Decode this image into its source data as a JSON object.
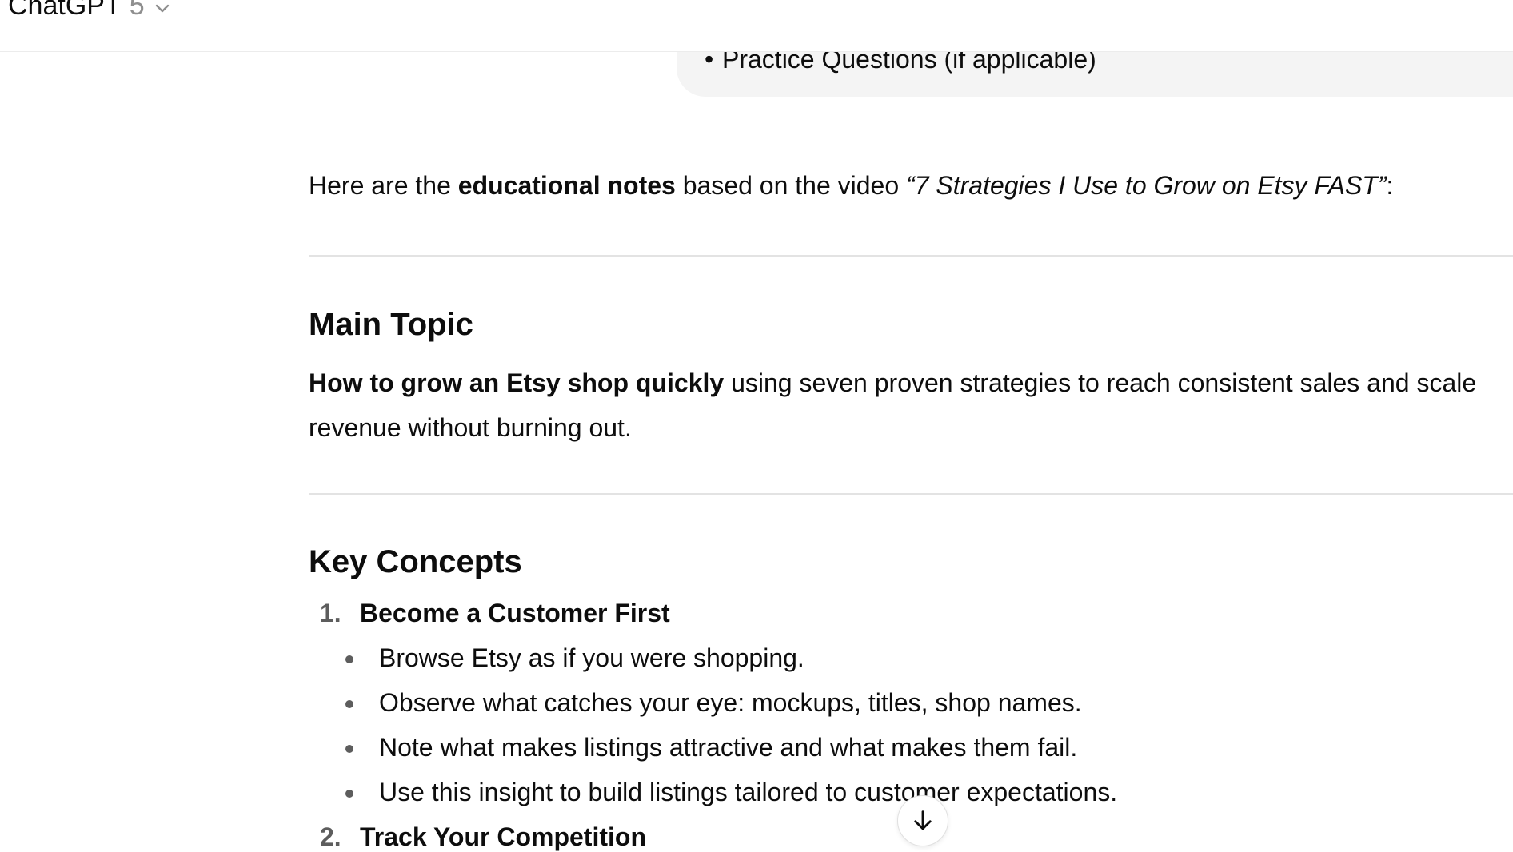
{
  "header": {
    "app_name": "ChatGPT",
    "model_version": "5"
  },
  "user_message": {
    "visible_bullet": "Practice Questions (if applicable)"
  },
  "response": {
    "intro": {
      "prefix": "Here are the ",
      "bold": "educational notes",
      "middle": " based on the video ",
      "italic": "“7 Strategies I Use to Grow on Etsy FAST”",
      "suffix": ":"
    },
    "main_topic": {
      "heading": "Main Topic",
      "bold": "How to grow an Etsy shop quickly",
      "rest": " using seven proven strategies to reach consistent sales and scale revenue without burning out."
    },
    "key_concepts": {
      "heading": "Key Concepts",
      "items": [
        {
          "number": "1.",
          "title": "Become a Customer First",
          "bullets": [
            "Browse Etsy as if you were shopping.",
            "Observe what catches your eye: mockups, titles, shop names.",
            "Note what makes listings attractive and what makes them fail.",
            "Use this insight to build listings tailored to customer expectations."
          ]
        },
        {
          "number": "2.",
          "title": "Track Your Competition"
        }
      ]
    }
  },
  "icons": {
    "model_dropdown": "chevron-down-icon",
    "scroll_down": "arrow-down-icon"
  },
  "colors": {
    "text": "#0d0d0d",
    "muted": "#8f8f8f",
    "bubble": "#f4f4f4",
    "divider": "#e3e3e3"
  }
}
